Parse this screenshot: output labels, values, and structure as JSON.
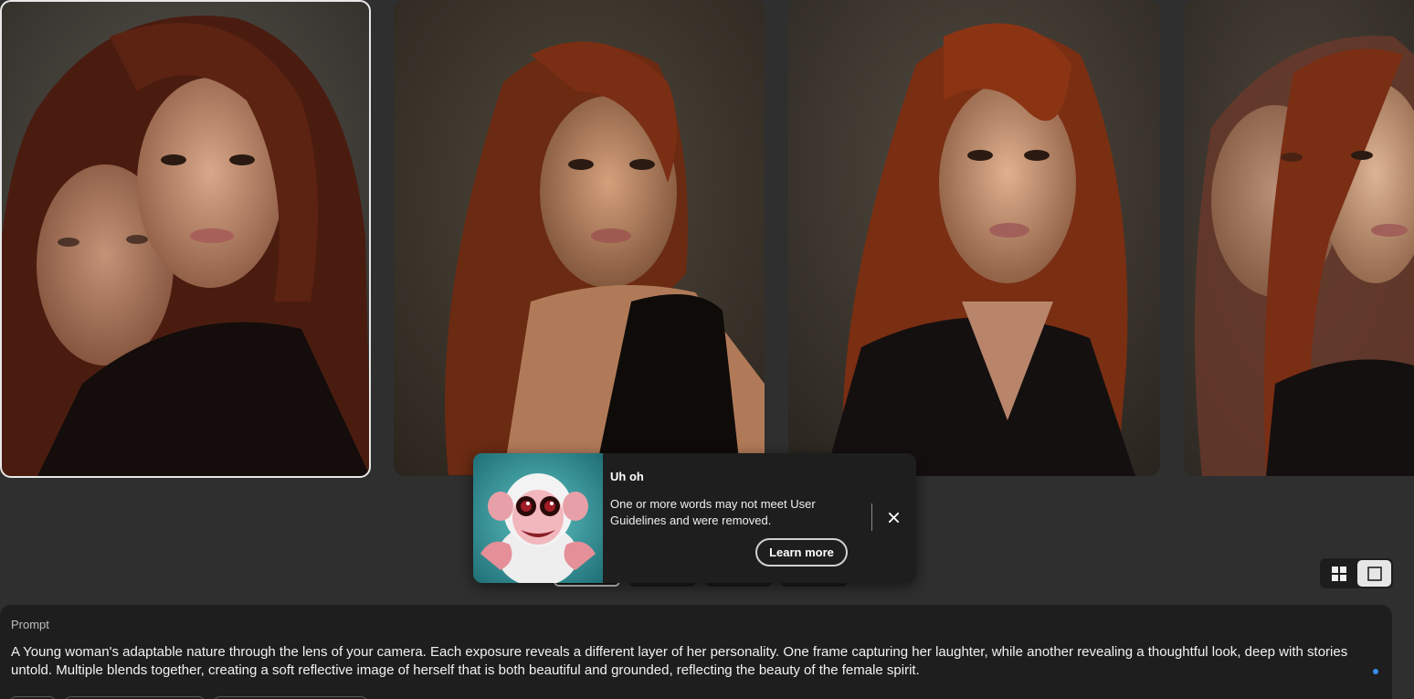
{
  "gallery": {
    "images": [
      {
        "label": "portrait-double-exposure-1",
        "selected": true
      },
      {
        "label": "portrait-2",
        "selected": false
      },
      {
        "label": "portrait-3",
        "selected": false
      },
      {
        "label": "portrait-double-exposure-4",
        "selected": false
      }
    ]
  },
  "view_toggle": {
    "options": [
      "grid-view",
      "single-view"
    ],
    "active": "single-view"
  },
  "toast": {
    "title": "Uh oh",
    "message": "One or more words may not meet User Guidelines and were removed.",
    "learn_more_label": "Learn more",
    "close_icon": "close-icon",
    "art_icon": "monkey-illustration"
  },
  "prompt": {
    "label": "Prompt",
    "text": "A Young woman's adaptable nature through the lens of your camera. Each exposure reveals a different layer of her personality. One frame capturing her laughter, while another revealing a thoughtful look, deep with stories untold. Multiple blends together, creating a soft reflective image of herself that is both beautiful and grounded, reflecting the beauty of the female spirit."
  },
  "colors": {
    "background": "#2f2f2f",
    "panel": "#1e1e1e",
    "accent_dot": "#378ef0",
    "hair": "#7a2a14"
  }
}
